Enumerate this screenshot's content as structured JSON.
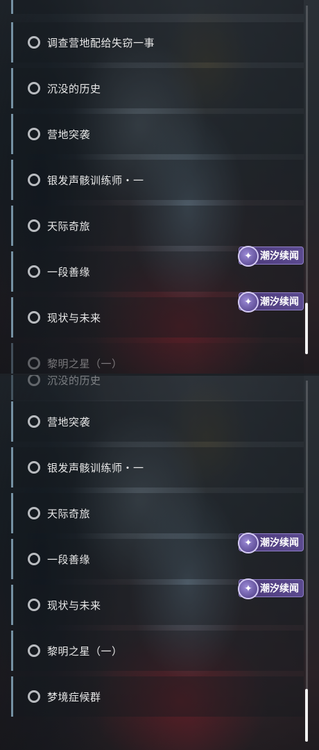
{
  "badge_text": "潮汐续闻",
  "top_panel": {
    "items": [
      {
        "label": "调查营地配给失窃一事"
      },
      {
        "label": "沉没的历史"
      },
      {
        "label": "营地突袭"
      },
      {
        "label": "银发声骸训练师・一"
      },
      {
        "label": "天际奇旅"
      },
      {
        "label": "一段善缘"
      },
      {
        "label": "现状与未来"
      },
      {
        "label": "黎明之星（一）"
      }
    ]
  },
  "bottom_panel": {
    "items": [
      {
        "label": "沉没的历史"
      },
      {
        "label": "营地突袭"
      },
      {
        "label": "银发声骸训练师・一"
      },
      {
        "label": "天际奇旅"
      },
      {
        "label": "一段善缘"
      },
      {
        "label": "现状与未来"
      },
      {
        "label": "黎明之星（一）"
      },
      {
        "label": "梦境症候群"
      }
    ]
  },
  "colors": {
    "accent_bar": "#7591a3",
    "badge_bg": "#5b4a8f"
  },
  "icons": {
    "quest_status": "empty-circle-icon",
    "badge": "tide-feather-icon"
  }
}
